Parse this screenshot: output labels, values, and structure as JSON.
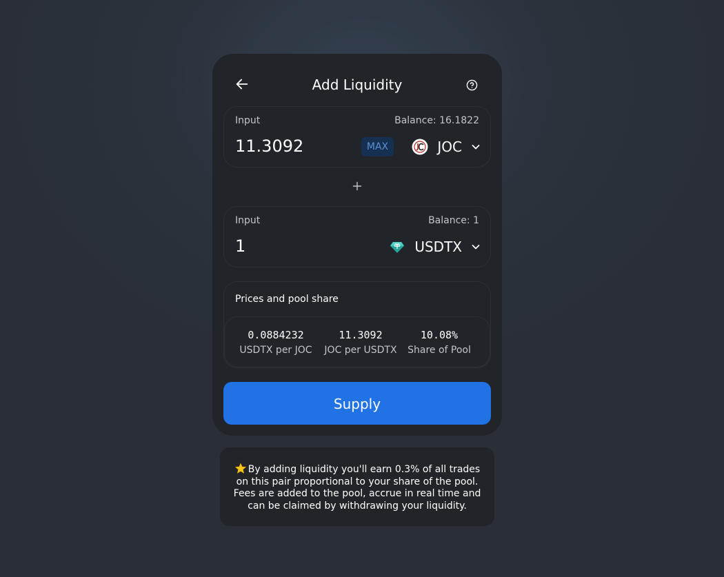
{
  "header": {
    "title": "Add Liquidity",
    "back_icon": "arrow-left-icon",
    "help_icon": "question-circle-icon"
  },
  "input_a": {
    "label": "Input",
    "balance": "Balance: 16.1822",
    "amount": "11.3092",
    "max_label": "MAX",
    "token": "JOC",
    "token_icon": "joc-token-icon"
  },
  "plus_icon": "plus-icon",
  "input_b": {
    "label": "Input",
    "balance": "Balance: 1",
    "amount": "1",
    "token": "USDTX",
    "token_icon": "usdtx-token-icon"
  },
  "pool": {
    "title": "Prices and pool share",
    "stats": [
      {
        "value": "0.0884232",
        "label": "USDTX per JOC"
      },
      {
        "value": "11.3092",
        "label": "JOC per USDTX"
      },
      {
        "value": "10.08%",
        "label": "Share of Pool"
      }
    ]
  },
  "supply_label": "Supply",
  "info": {
    "star_icon": "star-icon",
    "text": "By adding liquidity you'll earn 0.3% of all trades on this pair proportional to your share of the pool. Fees are added to the pool, accrue in real time and can be claimed by withdrawing your liquidity."
  },
  "colors": {
    "background": "#2b323c",
    "card": "#212429",
    "accent": "#2172e5",
    "max_bg": "#153050",
    "max_text": "#5b8fd6",
    "muted_text": "#c3c5cb",
    "border": "#2c2f36"
  }
}
